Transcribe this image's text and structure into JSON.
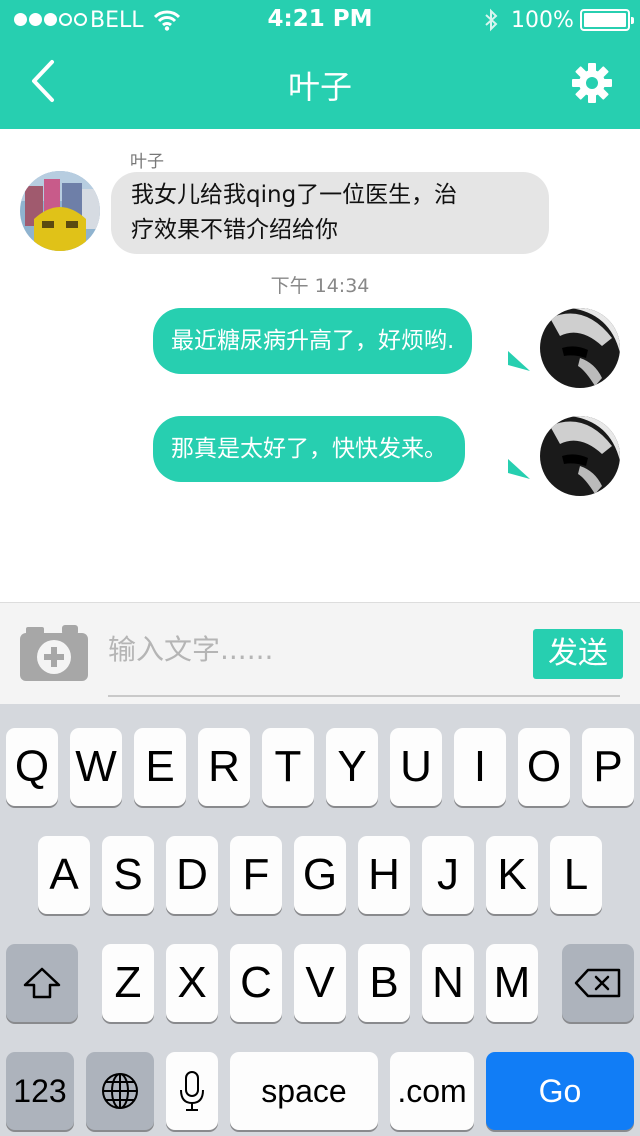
{
  "status_bar": {
    "carrier": "BELL",
    "time": "4:21 PM",
    "battery": "100%"
  },
  "header": {
    "title": "叶子",
    "back_icon": "chevron-left-icon",
    "settings_icon": "gear-icon"
  },
  "chat": {
    "incoming": {
      "sender": "叶子",
      "line1": "我女儿给我qing了一位医生，治",
      "line2": "疗效果不错介绍给你"
    },
    "timestamp": "下午 14:34",
    "outgoing": [
      {
        "text": "最近糖尿病升高了，好烦哟."
      },
      {
        "text": "那真是太好了，快快发来。"
      }
    ]
  },
  "input_bar": {
    "camera_icon": "camera-plus-icon",
    "placeholder": "输入文字......",
    "send_label": "发送"
  },
  "keyboard": {
    "row1": [
      "Q",
      "W",
      "E",
      "R",
      "T",
      "Y",
      "U",
      "I",
      "O",
      "P"
    ],
    "row2": [
      "A",
      "S",
      "D",
      "F",
      "G",
      "H",
      "J",
      "K",
      "L"
    ],
    "row3": [
      "Z",
      "X",
      "C",
      "V",
      "B",
      "N",
      "M"
    ],
    "shift_icon": "shift-icon",
    "delete_icon": "delete-icon",
    "numbers_label": "123",
    "globe_icon": "globe-icon",
    "mic_icon": "microphone-icon",
    "space_label": "space",
    "dotcom_label": ".com",
    "go_label": "Go"
  },
  "colors": {
    "accent": "#27cfb0",
    "go_key": "#117df6"
  }
}
